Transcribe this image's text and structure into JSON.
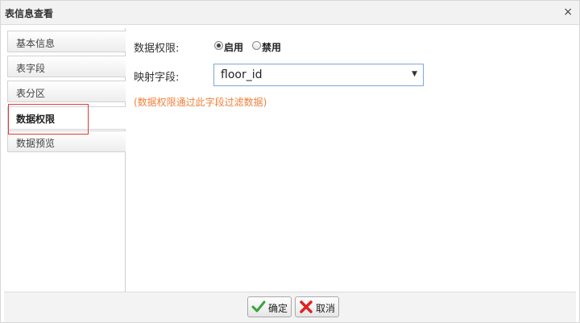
{
  "window": {
    "title": "表信息查看",
    "close_glyph": "×"
  },
  "sidebar": {
    "items": [
      {
        "label": "基本信息"
      },
      {
        "label": "表字段"
      },
      {
        "label": "表分区"
      },
      {
        "label": "数据权限"
      },
      {
        "label": "数据预览"
      }
    ],
    "active_index": 3
  },
  "content": {
    "permission_label": "数据权限:",
    "radio_enable": "启用",
    "radio_disable": "禁用",
    "mapping_label": "映射字段:",
    "mapping_value": "floor_id",
    "hint": "(数据权限通过此字段过滤数据)"
  },
  "footer": {
    "confirm_label": "确定",
    "cancel_label": "取消"
  },
  "colors": {
    "hint": "#f0803a",
    "highlight_border": "#e03a3a",
    "select_border": "#7fa7d6"
  }
}
